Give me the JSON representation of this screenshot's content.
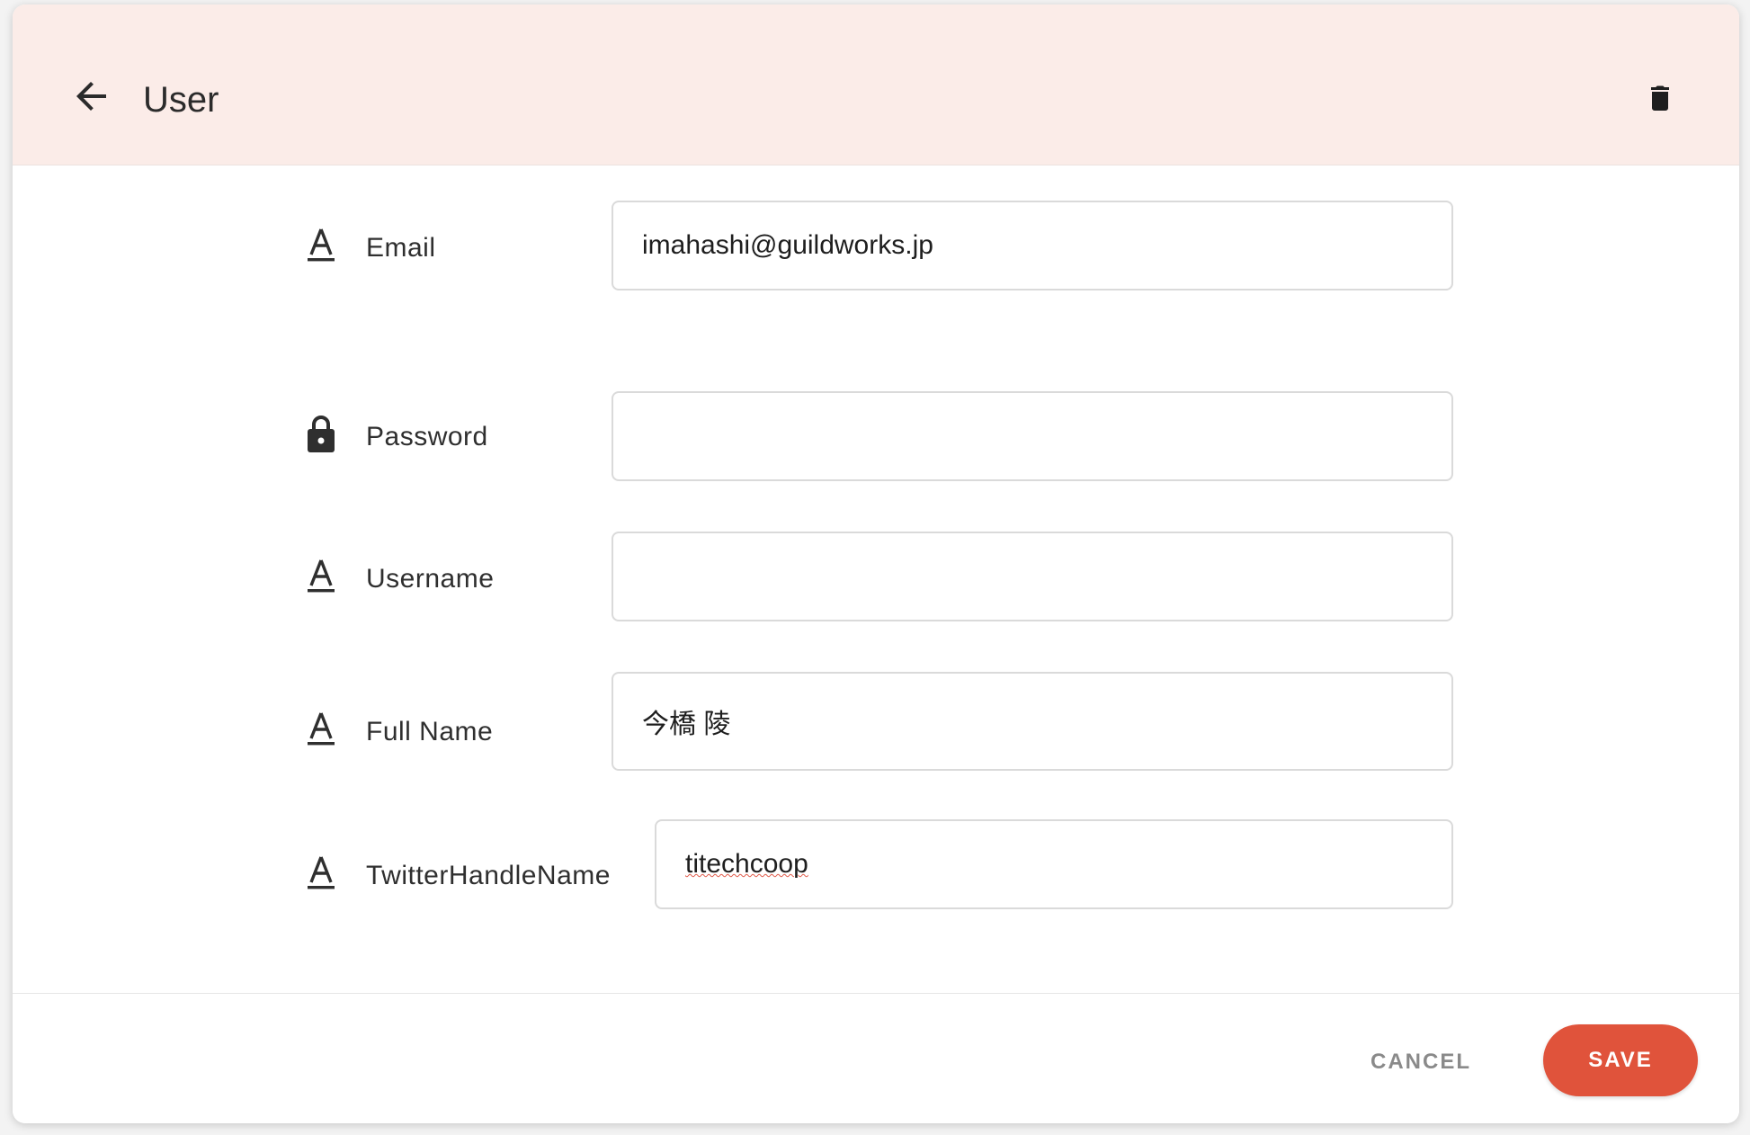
{
  "header": {
    "title": "User",
    "back_icon": "arrow-left-icon",
    "delete_icon": "trash-icon",
    "background": "#fbece8"
  },
  "form": {
    "email": {
      "label": "Email",
      "value": "imahashi@guildworks.jp",
      "icon": "text-field-icon"
    },
    "password": {
      "label": "Password",
      "value": "",
      "icon": "lock-icon"
    },
    "username": {
      "label": "Username",
      "value": "",
      "icon": "text-field-icon"
    },
    "full_name": {
      "label": "Full Name",
      "value": "今橋 陵",
      "icon": "text-field-icon"
    },
    "twitter": {
      "label": "TwitterHandleName",
      "value": "titechcoop",
      "icon": "text-field-icon"
    }
  },
  "footer": {
    "cancel_label": "CANCEL",
    "save_label": "SAVE",
    "save_color": "#e0533b"
  }
}
